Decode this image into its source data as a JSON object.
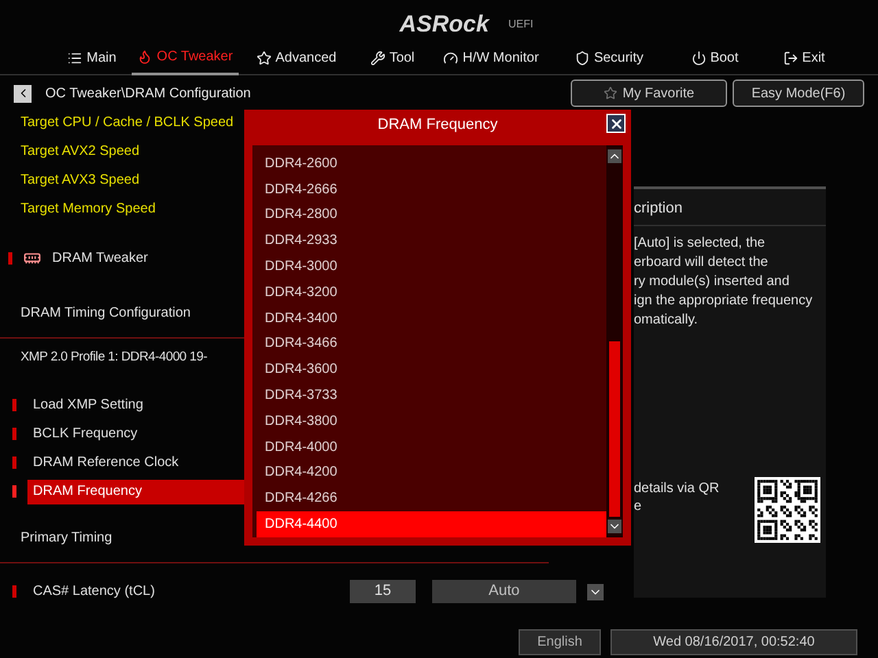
{
  "header": {
    "logo": "ASRock",
    "logo_suffix": "UEFI"
  },
  "tabs": [
    {
      "label": "Main",
      "selected": false
    },
    {
      "label": "OC Tweaker",
      "selected": true
    },
    {
      "label": "Advanced",
      "selected": false
    },
    {
      "label": "Tool",
      "selected": false
    },
    {
      "label": "H/W Monitor",
      "selected": false
    },
    {
      "label": "Security",
      "selected": false
    },
    {
      "label": "Boot",
      "selected": false
    },
    {
      "label": "Exit",
      "selected": false
    }
  ],
  "breadcrumb": "OC Tweaker\\DRAM Configuration",
  "top_buttons": [
    {
      "label": "My Favorite"
    },
    {
      "label": "Easy Mode(F6)"
    }
  ],
  "menu_items": [
    {
      "kind": "info",
      "label": "Target CPU / Cache / BCLK Speed"
    },
    {
      "kind": "info",
      "label": "Target AVX2 Speed"
    },
    {
      "kind": "info",
      "label": "Target AVX3 Speed"
    },
    {
      "kind": "info",
      "label": "Target Memory Speed"
    },
    {
      "kind": "submenu",
      "label": "DRAM Tweaker",
      "selected": false
    },
    {
      "kind": "heading",
      "label": "DRAM Timing Configuration"
    },
    {
      "kind": "text",
      "label": "XMP 2.0 Profile 1: DDR4-4000 19-"
    },
    {
      "kind": "setting",
      "label": "Load XMP Setting",
      "selected": false
    },
    {
      "kind": "setting",
      "label": "BCLK Frequency",
      "selected": false
    },
    {
      "kind": "setting",
      "label": "DRAM Reference Clock",
      "selected": false
    },
    {
      "kind": "setting",
      "label": "DRAM Frequency",
      "selected": true
    },
    {
      "kind": "heading",
      "label": "Primary Timing"
    },
    {
      "kind": "setting",
      "label": "CAS# Latency (tCL)",
      "selected": false,
      "value": "15",
      "option": "Auto"
    }
  ],
  "dialog": {
    "title": "DRAM Frequency",
    "options": [
      {
        "label": "DDR4-2600",
        "selected": false
      },
      {
        "label": "DDR4-2666",
        "selected": false
      },
      {
        "label": "DDR4-2800",
        "selected": false
      },
      {
        "label": "DDR4-2933",
        "selected": false
      },
      {
        "label": "DDR4-3000",
        "selected": false
      },
      {
        "label": "DDR4-3200",
        "selected": false
      },
      {
        "label": "DDR4-3400",
        "selected": false
      },
      {
        "label": "DDR4-3466",
        "selected": false
      },
      {
        "label": "DDR4-3600",
        "selected": false
      },
      {
        "label": "DDR4-3733",
        "selected": false
      },
      {
        "label": "DDR4-3800",
        "selected": false
      },
      {
        "label": "DDR4-4000",
        "selected": false
      },
      {
        "label": "DDR4-4200",
        "selected": false
      },
      {
        "label": "DDR4-4266",
        "selected": false
      },
      {
        "label": "DDR4-4400",
        "selected": true
      }
    ]
  },
  "description": {
    "title": "cription",
    "lines": [
      "[Auto] is selected, the",
      "erboard will detect the",
      "ry module(s) inserted and",
      "ign the appropriate frequency",
      "omatically."
    ],
    "qr_text": [
      "details via QR",
      "e"
    ]
  },
  "status_bar": {
    "language": "English",
    "datetime": "Wed 08/16/2017, 00:52:40"
  }
}
